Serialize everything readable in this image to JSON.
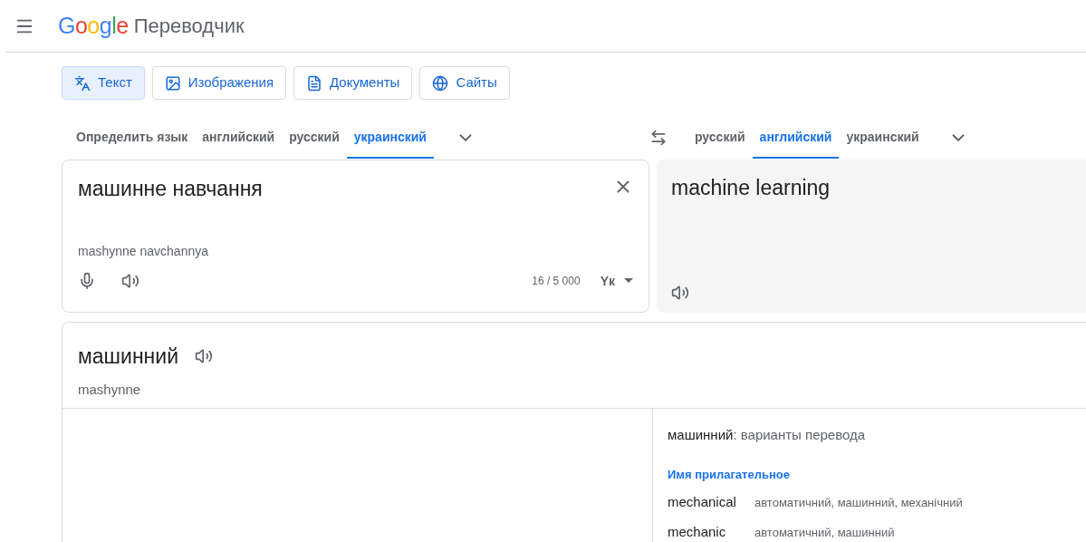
{
  "header": {
    "logo": "Google",
    "product": "Переводчик"
  },
  "modes": [
    {
      "label": "Текст",
      "kind": "translate",
      "selected": true
    },
    {
      "label": "Изображения",
      "kind": "image",
      "selected": false
    },
    {
      "label": "Документы",
      "kind": "document",
      "selected": false
    },
    {
      "label": "Сайты",
      "kind": "globe",
      "selected": false
    }
  ],
  "source_languages": [
    {
      "label": "Определить язык",
      "selected": false
    },
    {
      "label": "английский",
      "selected": false
    },
    {
      "label": "русский",
      "selected": false
    },
    {
      "label": "украинский",
      "selected": true
    }
  ],
  "target_languages": [
    {
      "label": "русский",
      "selected": false
    },
    {
      "label": "английский",
      "selected": true
    },
    {
      "label": "украинский",
      "selected": false
    }
  ],
  "source": {
    "value": "машинне навчання",
    "transliteration": "mashynne navchannya",
    "count": "16 / 5 000",
    "input_tool": "Yк"
  },
  "target": {
    "value": "machine learning"
  },
  "dictionary": {
    "word": "машинний",
    "transliteration": "mashynne",
    "variants_word": "машинний",
    "variants_title": ": варианты перевода",
    "part_of_speech": "Имя прилагательное",
    "entries": [
      {
        "word": "mechanical",
        "translations": "автоматичний, машинний, механічний"
      },
      {
        "word": "mechanic",
        "translations": "автоматичний, машинний"
      }
    ]
  }
}
